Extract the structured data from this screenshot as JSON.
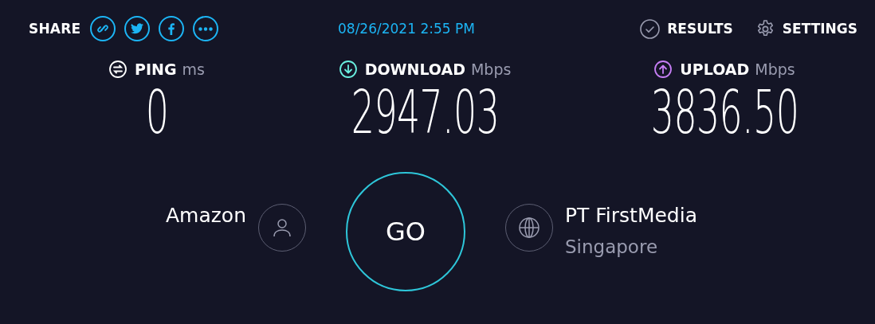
{
  "share": {
    "label": "SHARE",
    "buttons": [
      {
        "kind": "link"
      },
      {
        "kind": "twitter"
      },
      {
        "kind": "facebook"
      },
      {
        "kind": "more"
      }
    ]
  },
  "timestamp": "08/26/2021 2:55 PM",
  "nav": [
    {
      "kind": "results",
      "label": "RESULTS"
    },
    {
      "kind": "settings",
      "label": "SETTINGS"
    }
  ],
  "metrics": [
    {
      "kind": "ping",
      "label": "PING",
      "unit": "ms",
      "value": "0"
    },
    {
      "kind": "download",
      "label": "DOWNLOAD",
      "unit": "Mbps",
      "value": "2947.03"
    },
    {
      "kind": "upload",
      "label": "UPLOAD",
      "unit": "Mbps",
      "value": "3836.50"
    }
  ],
  "provider": {
    "name": "Amazon"
  },
  "go_button": {
    "label": "GO"
  },
  "server": {
    "name": "PT FirstMedia",
    "location": "Singapore"
  }
}
